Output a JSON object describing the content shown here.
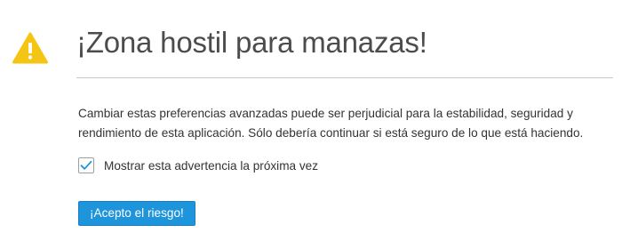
{
  "icon": {
    "name": "warning-icon",
    "color": "#f5c515"
  },
  "title": "¡Zona hostil para manazas!",
  "description": "Cambiar estas preferencias avanzadas puede ser perjudicial para la estabilidad, seguridad y rendimiento de esta aplicación. Sólo debería continuar si está seguro de lo que está haciendo.",
  "checkbox": {
    "label": "Mostrar esta advertencia la próxima vez",
    "checked": true,
    "check_color": "#1e95db"
  },
  "accept_button": {
    "label": "¡Acepto el riesgo!",
    "color": "#1e95db"
  }
}
